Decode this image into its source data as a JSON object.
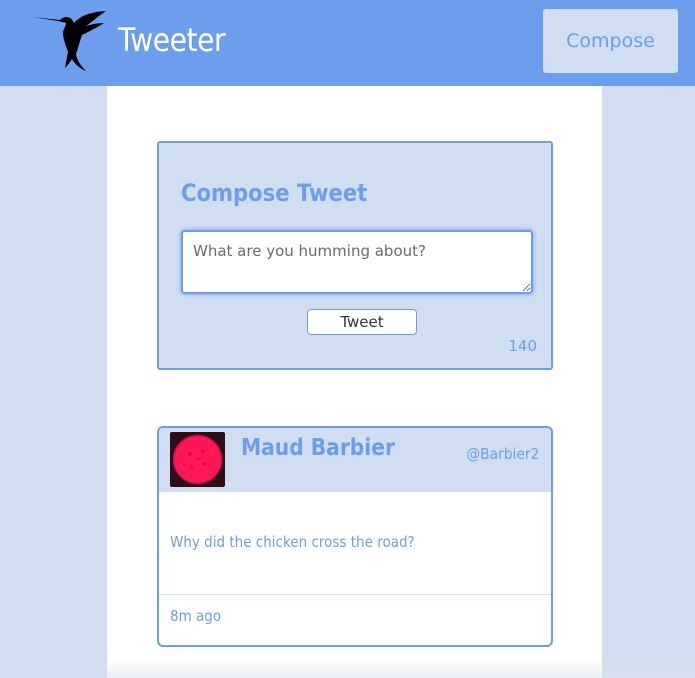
{
  "navbar": {
    "brand": "Tweeter",
    "logo_icon": "hummingbird-icon",
    "compose_label": "Compose"
  },
  "compose": {
    "title": "Compose Tweet",
    "placeholder": "What are you humming about?",
    "value": "",
    "submit_label": "Tweet",
    "counter": "140"
  },
  "tweets": [
    {
      "name": "Maud Barbier",
      "handle": "@Barbier2",
      "text": "Why did the chicken cross the road?",
      "time": "8m ago",
      "avatar_icon": "avatar-image"
    }
  ],
  "colors": {
    "accent": "#6d9ded",
    "background": "#d1ddf1",
    "avatar_fill": "#ff1654"
  }
}
